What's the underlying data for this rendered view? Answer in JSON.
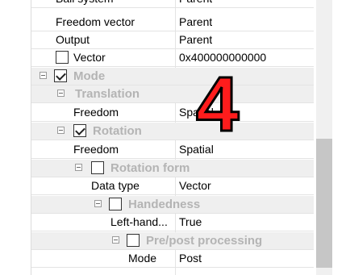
{
  "rows": [
    {
      "name": "Ball system",
      "value": "Parent"
    },
    {
      "name": "Freedom vector",
      "value": "Parent"
    },
    {
      "name": "Output",
      "value": "Parent"
    },
    {
      "name": "Vector",
      "value": "0x400000000000"
    },
    {
      "name": "Mode"
    },
    {
      "name": "Translation"
    },
    {
      "name": "Freedom",
      "value": "Spatial"
    },
    {
      "name": "Rotation"
    },
    {
      "name": "Freedom",
      "value": "Spatial"
    },
    {
      "name": "Rotation form"
    },
    {
      "name": "Data type",
      "value": "Vector"
    },
    {
      "name": "Handedness"
    },
    {
      "name": "Left-hand...",
      "value": "True"
    },
    {
      "name": "Pre/post processing"
    },
    {
      "name": "Mode",
      "value": "Post"
    }
  ],
  "overlay": {
    "number": "4"
  },
  "colors": {
    "overlay": "#ff1c1c",
    "category_text": "#b4b4b4",
    "category_bg": "#efefef"
  }
}
